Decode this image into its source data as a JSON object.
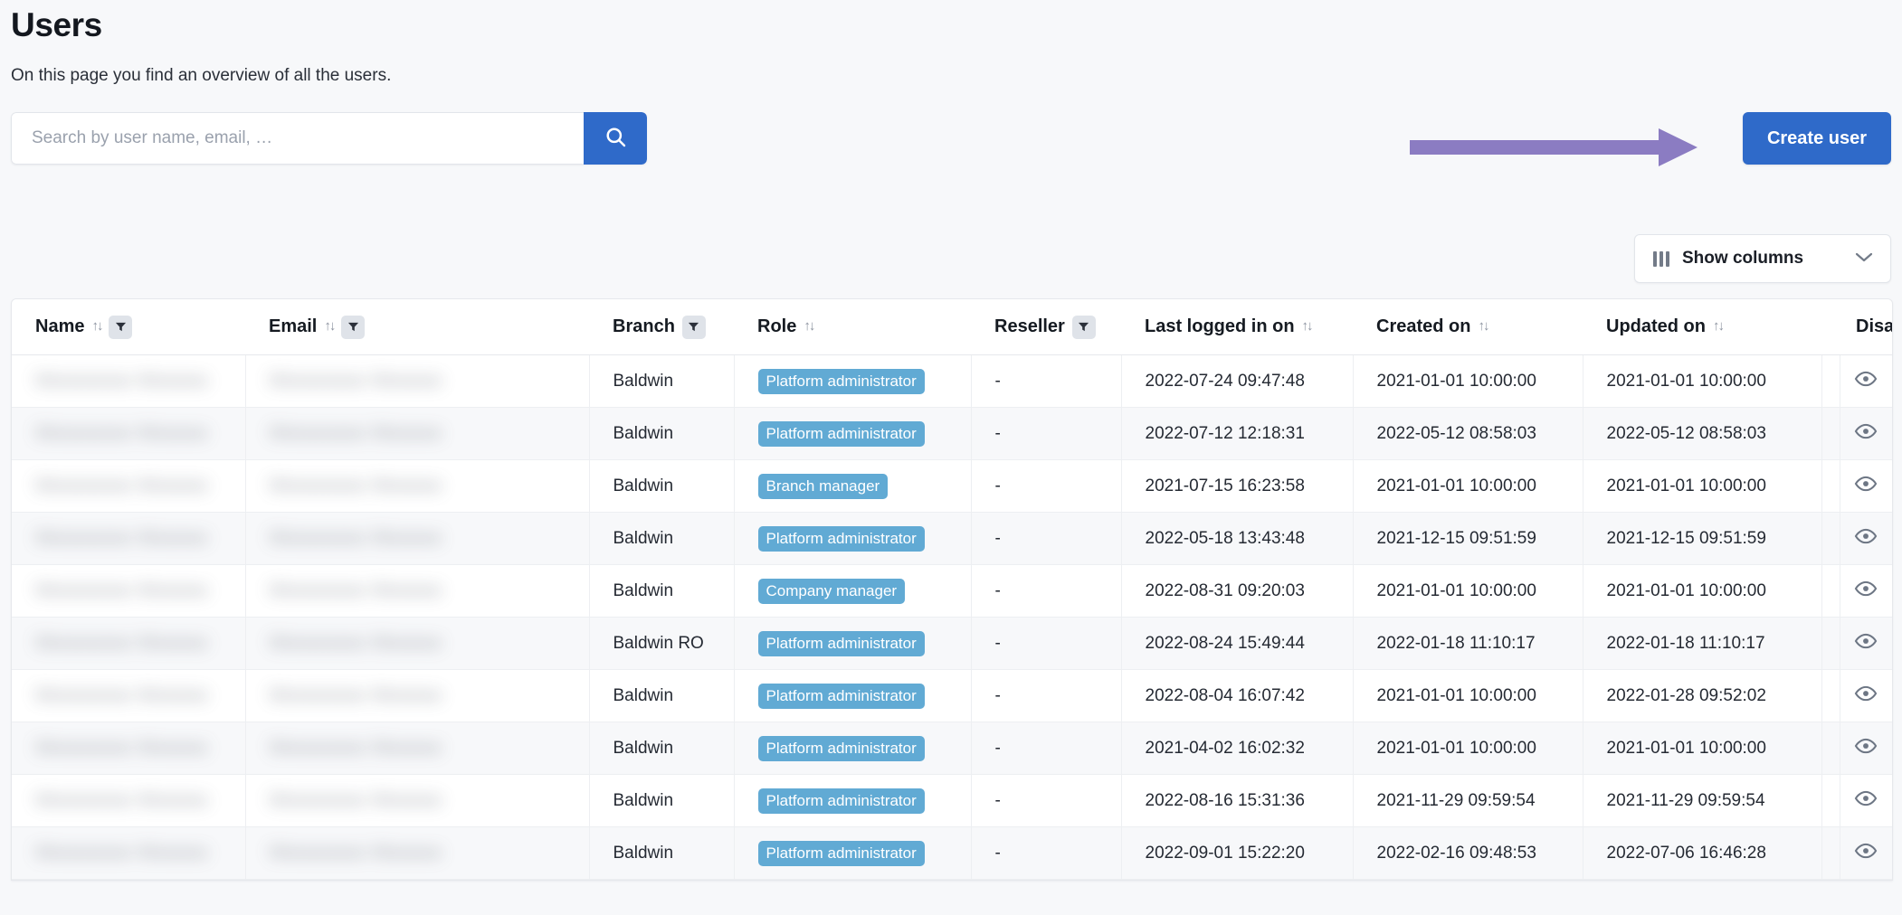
{
  "page": {
    "title": "Users",
    "subtitle": "On this page you find an overview of all the users."
  },
  "search": {
    "placeholder": "Search by user name, email, …",
    "value": "",
    "button_icon": "search-icon"
  },
  "actions": {
    "create_user_label": "Create user",
    "show_columns_label": "Show columns",
    "show_columns_icon": "columns-icon",
    "show_columns_chevron": "chevron-down-icon"
  },
  "annotation": {
    "type": "arrow",
    "direction": "right",
    "color": "#8b7cc2",
    "points_to": "create-user-button"
  },
  "colors": {
    "primary": "#2f6ac9",
    "badge": "#61aad4",
    "page_background": "#f7f8fa",
    "row_alt_background": "#f7f8fa",
    "filter_chip": "#dfe3e9",
    "annotation_arrow": "#8b7cc2"
  },
  "table": {
    "columns": [
      {
        "key": "name",
        "label": "Name",
        "sortable": true,
        "filterable": true,
        "redacted": true
      },
      {
        "key": "email",
        "label": "Email",
        "sortable": true,
        "filterable": true,
        "redacted": true
      },
      {
        "key": "branch",
        "label": "Branch",
        "sortable": false,
        "filterable": true,
        "redacted": false
      },
      {
        "key": "role",
        "label": "Role",
        "sortable": true,
        "filterable": false,
        "redacted": false
      },
      {
        "key": "reseller",
        "label": "Reseller",
        "sortable": false,
        "filterable": true,
        "redacted": false
      },
      {
        "key": "last",
        "label": "Last logged in on",
        "sortable": true,
        "filterable": false,
        "redacted": false
      },
      {
        "key": "created",
        "label": "Created on",
        "sortable": true,
        "filterable": false,
        "redacted": false
      },
      {
        "key": "updated",
        "label": "Updated on",
        "sortable": true,
        "filterable": false,
        "redacted": false
      },
      {
        "key": "spacer",
        "label": "",
        "sortable": false,
        "filterable": false,
        "redacted": false
      },
      {
        "key": "disabled",
        "label": "Disabled",
        "sortable": false,
        "filterable": false,
        "redacted": false
      }
    ],
    "rows": [
      {
        "name": "",
        "email": "",
        "branch": "Baldwin",
        "role": "Platform administrator",
        "reseller": "-",
        "last": "2022-07-24 09:47:48",
        "created": "2021-01-01 10:00:00",
        "updated": "2021-01-01 10:00:00",
        "disabled_icon": "eye-icon"
      },
      {
        "name": "",
        "email": "",
        "branch": "Baldwin",
        "role": "Platform administrator",
        "reseller": "-",
        "last": "2022-07-12 12:18:31",
        "created": "2022-05-12 08:58:03",
        "updated": "2022-05-12 08:58:03",
        "disabled_icon": "eye-icon"
      },
      {
        "name": "",
        "email": "",
        "branch": "Baldwin",
        "role": "Branch manager",
        "reseller": "-",
        "last": "2021-07-15 16:23:58",
        "created": "2021-01-01 10:00:00",
        "updated": "2021-01-01 10:00:00",
        "disabled_icon": "eye-icon"
      },
      {
        "name": "",
        "email": "",
        "branch": "Baldwin",
        "role": "Platform administrator",
        "reseller": "-",
        "last": "2022-05-18 13:43:48",
        "created": "2021-12-15 09:51:59",
        "updated": "2021-12-15 09:51:59",
        "disabled_icon": "eye-icon"
      },
      {
        "name": "",
        "email": "",
        "branch": "Baldwin",
        "role": "Company manager",
        "reseller": "-",
        "last": "2022-08-31 09:20:03",
        "created": "2021-01-01 10:00:00",
        "updated": "2021-01-01 10:00:00",
        "disabled_icon": "eye-icon"
      },
      {
        "name": "",
        "email": "",
        "branch": "Baldwin RO",
        "role": "Platform administrator",
        "reseller": "-",
        "last": "2022-08-24 15:49:44",
        "created": "2022-01-18 11:10:17",
        "updated": "2022-01-18 11:10:17",
        "disabled_icon": "eye-icon"
      },
      {
        "name": "",
        "email": "",
        "branch": "Baldwin",
        "role": "Platform administrator",
        "reseller": "-",
        "last": "2022-08-04 16:07:42",
        "created": "2021-01-01 10:00:00",
        "updated": "2022-01-28 09:52:02",
        "disabled_icon": "eye-icon"
      },
      {
        "name": "",
        "email": "",
        "branch": "Baldwin",
        "role": "Platform administrator",
        "reseller": "-",
        "last": "2021-04-02 16:02:32",
        "created": "2021-01-01 10:00:00",
        "updated": "2021-01-01 10:00:00",
        "disabled_icon": "eye-icon"
      },
      {
        "name": "",
        "email": "",
        "branch": "Baldwin",
        "role": "Platform administrator",
        "reseller": "-",
        "last": "2022-08-16 15:31:36",
        "created": "2021-11-29 09:59:54",
        "updated": "2021-11-29 09:59:54",
        "disabled_icon": "eye-icon"
      },
      {
        "name": "",
        "email": "",
        "branch": "Baldwin",
        "role": "Platform administrator",
        "reseller": "-",
        "last": "2022-09-01 15:22:20",
        "created": "2022-02-16 09:48:53",
        "updated": "2022-07-06 16:46:28",
        "disabled_icon": "eye-icon"
      }
    ],
    "redacted_placeholder": "Wwwwwww Wwwww"
  }
}
